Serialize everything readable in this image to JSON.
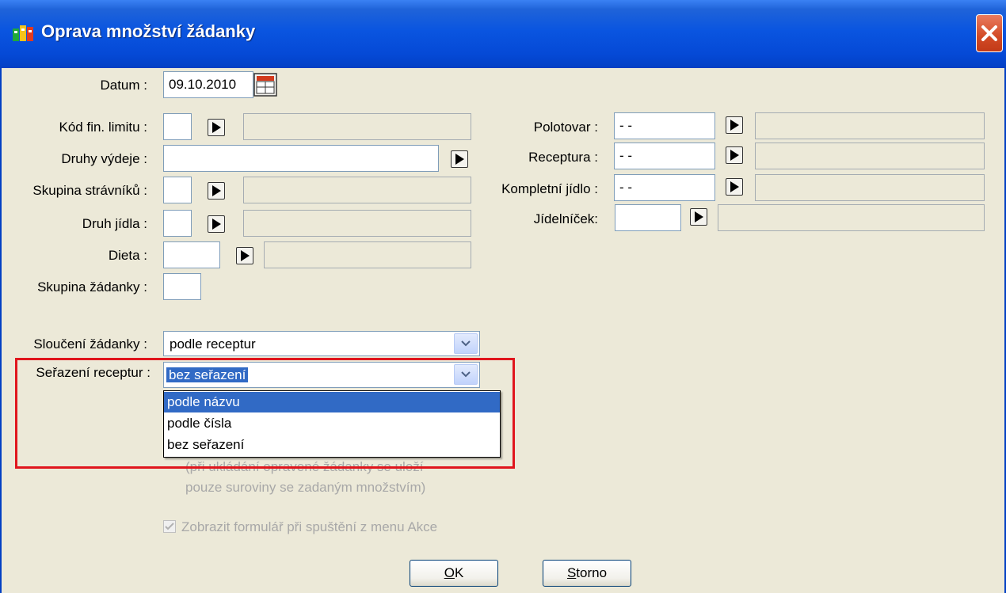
{
  "window": {
    "title": "Oprava množství žádanky"
  },
  "form": {
    "datum": {
      "label": "Datum :",
      "value": "09.10.2010"
    },
    "kod_fin_limitu": {
      "label": "Kód fin. limitu :"
    },
    "druhy_vydeje": {
      "label": "Druhy výdeje :"
    },
    "skupina_stravniku": {
      "label": "Skupina strávníků :"
    },
    "druh_jidla": {
      "label": "Druh jídla :"
    },
    "dieta": {
      "label": "Dieta :"
    },
    "skupina_zadanky": {
      "label": "Skupina žádanky :"
    },
    "polotovar": {
      "label": "Polotovar :",
      "value": "- -"
    },
    "receptura": {
      "label": "Receptura :",
      "value": "- -"
    },
    "kompletni_jidlo": {
      "label": "Kompletní jídlo :",
      "value": "- -"
    },
    "jidelnicek": {
      "label": "Jídelníček:"
    },
    "slouceni_zadanky": {
      "label": "Sloučení žádanky :",
      "value": "podle receptur"
    },
    "serazeni_receptur": {
      "label": "Seřazení receptur :",
      "value": "bez seřazení",
      "options": [
        "podle názvu",
        "podle čísla",
        "bez seřazení"
      ]
    }
  },
  "note": {
    "line1": "(při ukládání opravené žádanky se uloží",
    "line2": "pouze suroviny se zadaným množstvím)"
  },
  "checkbox": {
    "label": "Zobrazit formulář při spuštění z menu Akce",
    "checked": true
  },
  "buttons": {
    "ok_mnemonic": "O",
    "ok_rest": "K",
    "storno_mnemonic": "S",
    "storno_rest": "torno"
  },
  "colors": {
    "title_bar": "#0549D6",
    "selection": "#316AC5",
    "highlight_box": "#E0161D",
    "close_button": "#D24A25"
  }
}
